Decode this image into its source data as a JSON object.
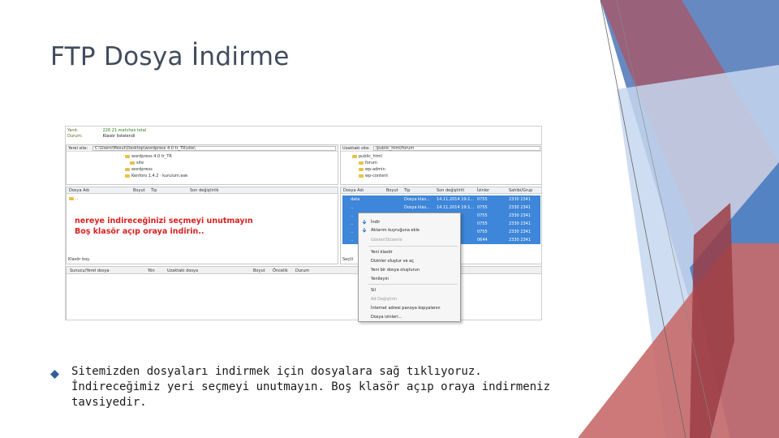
{
  "slide": {
    "title": "FTP Dosya İndirme",
    "bullet_text": "Sitemizden dosyaları indirmek için dosyalara sağ tıklıyoruz. İndireceğimiz yeri seçmeyi unutmayın. Boş klasör açıp oraya indirmeniz tavsiyedir."
  },
  "screenshot": {
    "log": [
      {
        "key": "Yanıt:",
        "value": "226 21 matches total"
      },
      {
        "key": "Durum:",
        "value": "Klasör listelendi"
      }
    ],
    "local_site": {
      "label": "Yerel site:",
      "path": "C:\\Users\\Mesut\\Desktop\\wordpress 4.0 tr_TR\\site\\",
      "tree": [
        {
          "name": "wordpress 4.0 tr_TR"
        },
        {
          "name": "site"
        },
        {
          "name": "wordpress"
        },
        {
          "name": "Kenforo 1.4.2 · kurulum.exe"
        }
      ],
      "columns": [
        "Dosya Adı",
        "Boyut",
        "Tip",
        "Son değiştirilk"
      ],
      "status": "Klasör boş."
    },
    "remote_site": {
      "label": "Uzaktaki site:",
      "path": "/public_html/forum",
      "tree": [
        {
          "name": "public_html"
        },
        {
          "name": "forum"
        },
        {
          "name": "wp-admin"
        },
        {
          "name": "wp-content"
        }
      ],
      "columns": [
        "Dosya Adı",
        "Boyut",
        "Tip",
        "Son değiştirili",
        "İzinler",
        "Sahibi/Grup"
      ],
      "rows": [
        {
          "name": "data",
          "type": "Dosya klas...",
          "modified": "14.11.2014 19:1...",
          "perms": "0755",
          "owner": "2330 2341"
        },
        {
          "name": "..",
          "type": "Dosya klas...",
          "modified": "14.11.2014 19:1...",
          "perms": "0755",
          "owner": "2330 2341"
        },
        {
          "name": "..",
          "type": "",
          "modified": "",
          "perms": "0755",
          "owner": "2330 2341"
        },
        {
          "name": "..",
          "type": "",
          "modified": "",
          "perms": "0755",
          "owner": "2330 2341"
        },
        {
          "name": "..",
          "type": "",
          "modified": "",
          "perms": "0755",
          "owner": "2330 2341"
        },
        {
          "name": "..",
          "type": "",
          "modified": "",
          "perms": "0644",
          "owner": "2330 2341"
        }
      ],
      "status": "Seçili"
    },
    "queue_columns": [
      "Sunucu/Yerel dosya",
      "Yön",
      "Uzaktaki dosya",
      "Boyut",
      "Öncelik",
      "Durum"
    ],
    "annotation": {
      "line1": "nereye indireceğinizi seçmeyi unutmayın",
      "line2": "Boş klasör açıp oraya indirin.."
    },
    "context_menu": [
      {
        "label": "İndir",
        "disabled": false
      },
      {
        "label": "Aktarım kuyruğuna ekle",
        "disabled": false
      },
      {
        "label": "Göster/Düzenle",
        "disabled": true
      },
      {
        "label": "Yeni klasör",
        "disabled": false
      },
      {
        "label": "Dizinler oluştur ve aç",
        "disabled": false
      },
      {
        "label": "Yeni bir dosya oluşturun",
        "disabled": false
      },
      {
        "label": "Yenileyin",
        "disabled": false
      },
      {
        "label": "Sil",
        "disabled": false
      },
      {
        "label": "Ad Değiştirin",
        "disabled": true
      },
      {
        "label": "İnternet adresi panoya kopyalanın",
        "disabled": false
      },
      {
        "label": "Dosya izinleri...",
        "disabled": false
      }
    ]
  },
  "colors": {
    "title": "#404c5c",
    "accent_blue": "#3d86d9",
    "deco_red": "#c75c5c",
    "deco_blue": "#4f7fc0",
    "note_red": "#d81f1f"
  },
  "icons": {
    "bullet": "diamond-bullet-icon",
    "folder": "folder-icon",
    "download": "download-arrow-icon"
  }
}
